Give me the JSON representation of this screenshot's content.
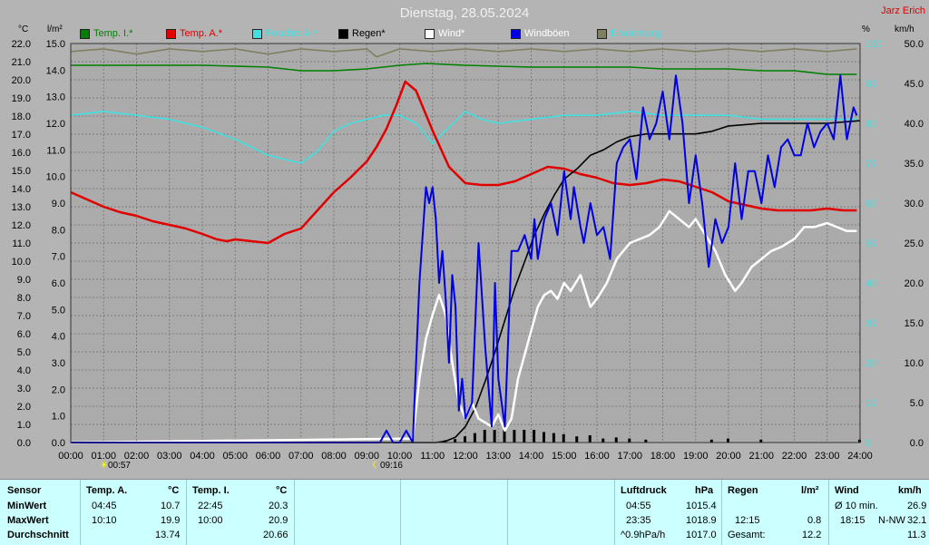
{
  "title": "Dienstag, 28.05.2024",
  "author": "Jarz Erich",
  "units": {
    "temp": "°C",
    "rain": "l/m²",
    "hum": "%",
    "wind": "km/h"
  },
  "legend": [
    {
      "label": "Temp. I.*",
      "color": "#008000"
    },
    {
      "label": "Temp. A.*",
      "color": "#e00000"
    },
    {
      "label": "Feuchte A.*",
      "color": "#40e0e0"
    },
    {
      "label": "Regen*",
      "color": "#000000"
    },
    {
      "label": "Wind*",
      "color": "#ffffff"
    },
    {
      "label": "Windböen",
      "color": "#0000e0"
    },
    {
      "label": "Erwärmung",
      "color": "#808060"
    }
  ],
  "markers": [
    {
      "label": "00:57"
    },
    {
      "label": "09:16"
    }
  ],
  "chart_data": {
    "type": "line",
    "xlabel": "",
    "ylabel": "",
    "x_ticks": [
      "00:00",
      "01:00",
      "02:00",
      "03:00",
      "04:00",
      "05:00",
      "06:00",
      "07:00",
      "08:00",
      "09:00",
      "10:00",
      "11:00",
      "12:00",
      "13:00",
      "14:00",
      "15:00",
      "16:00",
      "17:00",
      "18:00",
      "19:00",
      "20:00",
      "21:00",
      "22:00",
      "23:00",
      "24:00"
    ],
    "axes": {
      "temp": {
        "min": 0,
        "max": 22,
        "ticks": [
          "0.0",
          "1.0",
          "2.0",
          "3.0",
          "4.0",
          "5.0",
          "6.0",
          "7.0",
          "8.0",
          "9.0",
          "10.0",
          "11.0",
          "12.0",
          "13.0",
          "14.0",
          "15.0",
          "16.0",
          "17.0",
          "18.0",
          "19.0",
          "20.0",
          "21.0",
          "22.0"
        ]
      },
      "rain": {
        "min": 0,
        "max": 15,
        "ticks": [
          "0.0",
          "1.0",
          "2.0",
          "3.0",
          "4.0",
          "5.0",
          "6.0",
          "7.0",
          "8.0",
          "9.0",
          "10.0",
          "11.0",
          "12.0",
          "13.0",
          "14.0",
          "15.0"
        ]
      },
      "hum": {
        "min": 0,
        "max": 100,
        "ticks": [
          "0",
          "10",
          "20",
          "30",
          "40",
          "50",
          "60",
          "70",
          "80",
          "90",
          "100"
        ]
      },
      "wind": {
        "min": 0,
        "max": 50,
        "ticks": [
          "0.0",
          "5.0",
          "10.0",
          "15.0",
          "20.0",
          "25.0",
          "30.0",
          "35.0",
          "40.0",
          "45.0",
          "50.0"
        ]
      }
    },
    "grid": true,
    "series": [
      {
        "name": "Temp. I.*",
        "axis": "temp",
        "color": "#008000",
        "x": [
          0,
          2,
          4,
          6,
          7,
          8,
          9,
          10,
          10.8,
          12,
          14,
          16,
          17,
          18,
          19,
          20,
          21,
          22,
          23,
          23.9
        ],
        "y": [
          20.8,
          20.8,
          20.8,
          20.7,
          20.5,
          20.5,
          20.6,
          20.8,
          20.9,
          20.8,
          20.7,
          20.7,
          20.7,
          20.6,
          20.6,
          20.6,
          20.5,
          20.5,
          20.3,
          20.3
        ]
      },
      {
        "name": "Temp. A.*",
        "axis": "temp",
        "color": "#e00000",
        "x": [
          0,
          0.5,
          1,
          1.5,
          2,
          2.5,
          3,
          3.5,
          4,
          4.45,
          4.75,
          5,
          5.5,
          6,
          6.5,
          7,
          7.5,
          8,
          8.5,
          9,
          9.3,
          9.6,
          9.9,
          10.17,
          10.5,
          11,
          11.5,
          12,
          12.5,
          13,
          13.5,
          14,
          14.5,
          15,
          15.5,
          16,
          16.5,
          17,
          17.5,
          18,
          18.5,
          19,
          19.5,
          20,
          20.5,
          21,
          21.5,
          22,
          22.5,
          23,
          23.5,
          23.9
        ],
        "y": [
          13.8,
          13.4,
          13.0,
          12.7,
          12.5,
          12.2,
          12.0,
          11.8,
          11.5,
          11.2,
          11.1,
          11.2,
          11.1,
          11.0,
          11.5,
          11.8,
          12.8,
          13.8,
          14.6,
          15.5,
          16.3,
          17.3,
          18.6,
          19.9,
          19.4,
          17.2,
          15.2,
          14.3,
          14.2,
          14.2,
          14.4,
          14.8,
          15.2,
          15.1,
          14.8,
          14.6,
          14.3,
          14.2,
          14.3,
          14.5,
          14.4,
          14.1,
          13.8,
          13.3,
          13.1,
          12.9,
          12.8,
          12.8,
          12.8,
          12.9,
          12.8,
          12.8
        ]
      },
      {
        "name": "Feuchte A.*",
        "axis": "hum",
        "color": "#40e0e0",
        "x": [
          0,
          1,
          2,
          3,
          4,
          5,
          6,
          6.5,
          7,
          7.5,
          8,
          8.5,
          9,
          9.5,
          10,
          10.5,
          11,
          11.5,
          12,
          12.5,
          13,
          14,
          15,
          16,
          17,
          18,
          19,
          20,
          21,
          22,
          23,
          23.9
        ],
        "y": [
          82,
          83,
          82,
          81,
          79,
          76,
          72,
          71,
          70,
          73,
          78,
          80,
          81,
          82,
          82,
          80,
          75,
          79,
          83,
          81,
          80,
          81,
          82,
          82,
          83,
          82,
          82,
          82,
          81,
          81,
          81,
          81
        ]
      },
      {
        "name": "Regen*",
        "axis": "rain",
        "color": "#000000",
        "x": [
          0,
          11.1,
          11.4,
          11.7,
          12,
          12.3,
          12.6,
          12.9,
          13.2,
          13.5,
          13.8,
          14.1,
          14.4,
          14.7,
          15.0,
          15.4,
          15.8,
          16.2,
          16.6,
          17,
          17.5,
          18,
          18.5,
          19,
          19.5,
          20,
          21,
          22,
          23,
          24
        ],
        "y": [
          0,
          0,
          0.05,
          0.2,
          0.6,
          1.3,
          2.3,
          3.4,
          4.6,
          5.8,
          6.8,
          7.8,
          8.6,
          9.3,
          9.9,
          10.3,
          10.8,
          11.0,
          11.3,
          11.5,
          11.6,
          11.6,
          11.6,
          11.6,
          11.7,
          11.9,
          12.0,
          12.0,
          12.0,
          12.1
        ]
      },
      {
        "name": "Wind*",
        "axis": "wind",
        "color": "#ffffff",
        "x": [
          0,
          10.4,
          10.6,
          10.8,
          11.0,
          11.2,
          11.4,
          11.6,
          11.8,
          12.0,
          12.2,
          12.4,
          12.6,
          12.8,
          13.0,
          13.2,
          13.4,
          13.6,
          13.8,
          14.0,
          14.2,
          14.4,
          14.6,
          14.8,
          15.0,
          15.2,
          15.5,
          15.8,
          16.0,
          16.3,
          16.6,
          17.0,
          17.3,
          17.6,
          17.9,
          18.2,
          18.5,
          18.8,
          19.0,
          19.3,
          19.6,
          19.9,
          20.2,
          20.4,
          20.7,
          21.0,
          21.3,
          21.6,
          22.0,
          22.3,
          22.6,
          23.0,
          23.3,
          23.6,
          23.9
        ],
        "y": [
          0,
          0.5,
          8,
          13,
          16,
          18.5,
          16,
          10,
          5,
          3,
          5,
          3,
          2.5,
          2,
          3.5,
          1.5,
          3,
          8,
          11,
          14,
          17,
          18.5,
          19,
          18,
          20,
          19,
          21,
          17,
          18,
          20,
          23,
          25,
          25.5,
          26,
          27,
          29,
          28,
          27,
          28,
          26,
          24,
          21,
          19,
          20,
          22,
          23,
          24,
          24.5,
          25.5,
          27,
          27,
          27.5,
          27,
          26.5,
          26.5
        ]
      },
      {
        "name": "Windböen",
        "axis": "wind",
        "color": "#0000e0",
        "x": [
          0,
          9.4,
          9.6,
          9.8,
          10,
          10.2,
          10.4,
          10.6,
          10.8,
          10.9,
          11.0,
          11.1,
          11.2,
          11.3,
          11.4,
          11.5,
          11.6,
          11.7,
          11.8,
          11.9,
          12.0,
          12.2,
          12.4,
          12.6,
          12.8,
          12.9,
          13.0,
          13.2,
          13.4,
          13.6,
          13.8,
          14.0,
          14.1,
          14.2,
          14.4,
          14.6,
          14.8,
          15.0,
          15.2,
          15.3,
          15.5,
          15.6,
          15.8,
          16.0,
          16.2,
          16.4,
          16.6,
          16.8,
          17.0,
          17.2,
          17.4,
          17.6,
          17.8,
          18.0,
          18.2,
          18.4,
          18.6,
          18.8,
          19.0,
          19.2,
          19.4,
          19.6,
          19.8,
          20.0,
          20.2,
          20.4,
          20.6,
          20.8,
          21.0,
          21.2,
          21.4,
          21.6,
          21.8,
          22.0,
          22.2,
          22.4,
          22.6,
          22.8,
          23.0,
          23.2,
          23.4,
          23.6,
          23.8,
          23.9
        ],
        "y": [
          0,
          0,
          1.5,
          0,
          0,
          1.5,
          0,
          20,
          32,
          30,
          32,
          28,
          20,
          24,
          18,
          10,
          21,
          17,
          4,
          8,
          3,
          5,
          25,
          12,
          2,
          20,
          8,
          2,
          24,
          24,
          26,
          23,
          28,
          23,
          28,
          30,
          26,
          34,
          28,
          32,
          27,
          25,
          30,
          26,
          27,
          23,
          35,
          37,
          38,
          33,
          42,
          38,
          40,
          44,
          38,
          46,
          40,
          30,
          36,
          30,
          22,
          28,
          25,
          27,
          35,
          28,
          34,
          34,
          30,
          36,
          32,
          37,
          38,
          36,
          36,
          40,
          37,
          39,
          40,
          38,
          46,
          38,
          42,
          41
        ]
      },
      {
        "name": "Erwärmung",
        "axis": "rain",
        "color": "#808060",
        "x": [
          0,
          1,
          2,
          3,
          4,
          5,
          6,
          7,
          8,
          9,
          9.3,
          10,
          11,
          12,
          13,
          14,
          15,
          16,
          17,
          18,
          19,
          20,
          21,
          22,
          23,
          23.9
        ],
        "y": [
          14.7,
          14.8,
          14.6,
          14.8,
          14.7,
          14.8,
          14.6,
          14.8,
          14.7,
          14.8,
          14.5,
          14.8,
          14.7,
          14.8,
          14.7,
          14.8,
          14.7,
          14.8,
          14.7,
          14.8,
          14.7,
          14.8,
          14.7,
          14.8,
          14.7,
          14.8
        ]
      }
    ]
  },
  "table": {
    "sensor_label": "Sensor",
    "rows": [
      "MinWert",
      "MaxWert",
      "Durchschnitt"
    ],
    "temp_a": {
      "head": "Temp. A.",
      "unit": "°C",
      "min_time": "04:45",
      "min": "10.7",
      "max_time": "10:10",
      "max": "19.9",
      "avg": "13.74"
    },
    "temp_i": {
      "head": "Temp. I.",
      "unit": "°C",
      "min_time": "22:45",
      "min": "20.3",
      "max_time": "10:00",
      "max": "20.9",
      "avg": "20.66"
    },
    "pressure": {
      "head": "Luftdruck",
      "unit": "hPa",
      "min_time": "04:55",
      "min": "1015.4",
      "max_time": "23:35",
      "max": "1018.9",
      "trend": "^0.9hPa/h",
      "current": "1017.0"
    },
    "rain": {
      "head": "Regen",
      "unit": "l/m²",
      "max_time": "12:15",
      "max": "0.8",
      "total_label": "Gesamt:",
      "total": "12.2"
    },
    "wind": {
      "head": "Wind",
      "unit": "km/h",
      "avg_label": "Ø 10 min.",
      "avg": "26.9",
      "max_time": "18:15",
      "max_dir": "N-NW",
      "max": "32.1",
      "mean": "11.3"
    }
  }
}
